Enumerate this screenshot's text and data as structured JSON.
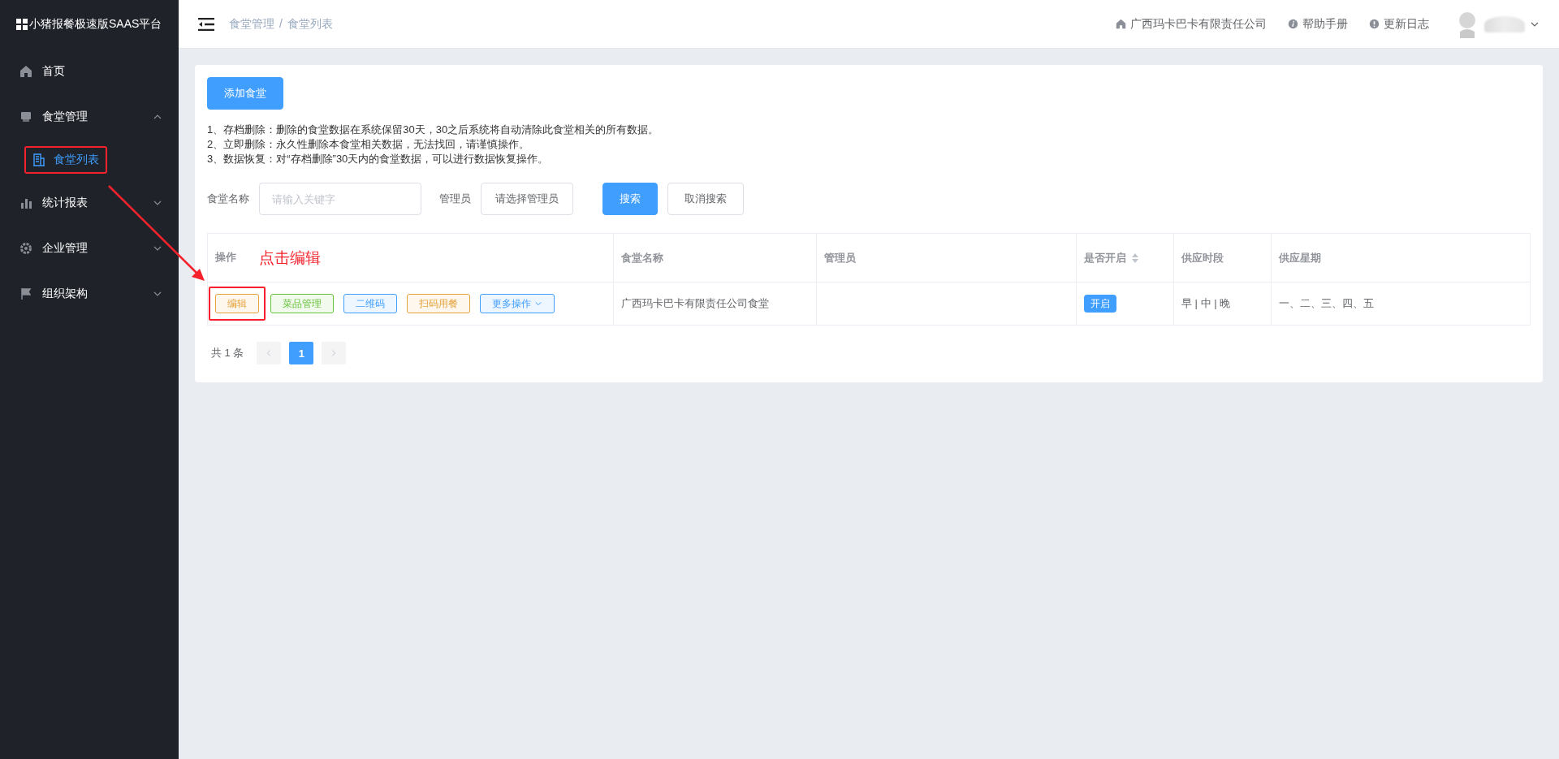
{
  "sidebar": {
    "title": "小猪报餐极速版SAAS平台",
    "items": [
      {
        "label": "首页",
        "selected": false
      },
      {
        "label": "食堂管理",
        "selected": false,
        "expanded": true,
        "children": [
          {
            "label": "食堂列表",
            "selected": true,
            "highlighted": true
          }
        ]
      },
      {
        "label": "统计报表",
        "selected": false,
        "expanded": false
      },
      {
        "label": "企业管理",
        "selected": false,
        "expanded": false
      },
      {
        "label": "组织架构",
        "selected": false,
        "expanded": false
      }
    ]
  },
  "header": {
    "breadcrumb": [
      "食堂管理",
      "食堂列表"
    ],
    "breadcrumb_separator": "/",
    "links": [
      "广西玛卡巴卡有限责任公司",
      "帮助手册",
      "更新日志"
    ]
  },
  "toolbar": {
    "add_button": "添加食堂"
  },
  "notes": [
    "1、存档删除：删除的食堂数据在系统保留30天，30之后系统将自动清除此食堂相关的所有数据。",
    "2、立即删除：永久性删除本食堂相关数据，无法找回，请谨慎操作。",
    "3、数据恢复：对“存档删除”30天内的食堂数据，可以进行数据恢复操作。"
  ],
  "filters": [
    {
      "kind": "input",
      "label": "食堂名称",
      "placeholder": "请输入关键字"
    },
    {
      "kind": "select",
      "label": "管理员",
      "text": "请选择管理员"
    }
  ],
  "search_buttons": [
    {
      "kind": "primary",
      "label": "搜索"
    },
    {
      "kind": "default",
      "label": "取消搜索"
    }
  ],
  "table": {
    "annotation": "点击编辑",
    "columns": [
      {
        "label": "操作",
        "sortable": false
      },
      {
        "label": "食堂名称",
        "sortable": false
      },
      {
        "label": "管理员",
        "sortable": false
      },
      {
        "label": "是否开启",
        "sortable": true
      },
      {
        "label": "供应时段",
        "sortable": false
      },
      {
        "label": "供应星期",
        "sortable": false
      }
    ],
    "rows": [
      {
        "actions": [
          {
            "label": "编辑",
            "kind": "button",
            "color": "#e6a23c",
            "highlighted": true
          },
          {
            "label": "菜品管理",
            "kind": "button",
            "color": "#67c23a",
            "highlighted": false
          },
          {
            "label": "二维码",
            "kind": "button",
            "color": "#409eff",
            "highlighted": false
          },
          {
            "label": "扫码用餐",
            "kind": "button",
            "color": "#e6a23c",
            "highlighted": false
          },
          {
            "label": "更多操作",
            "kind": "dropdown",
            "color": "#409eff",
            "highlighted": false
          }
        ],
        "name": "广西玛卡巴卡有限责任公司食堂",
        "status": {
          "label": "开启",
          "on": true
        },
        "periods": "早 | 中 | 晚",
        "weekdays": "一、二、三、四、五"
      }
    ]
  },
  "pagination": {
    "total": "共 1 条",
    "pages": [
      {
        "label": "1",
        "selected": true
      }
    ]
  }
}
